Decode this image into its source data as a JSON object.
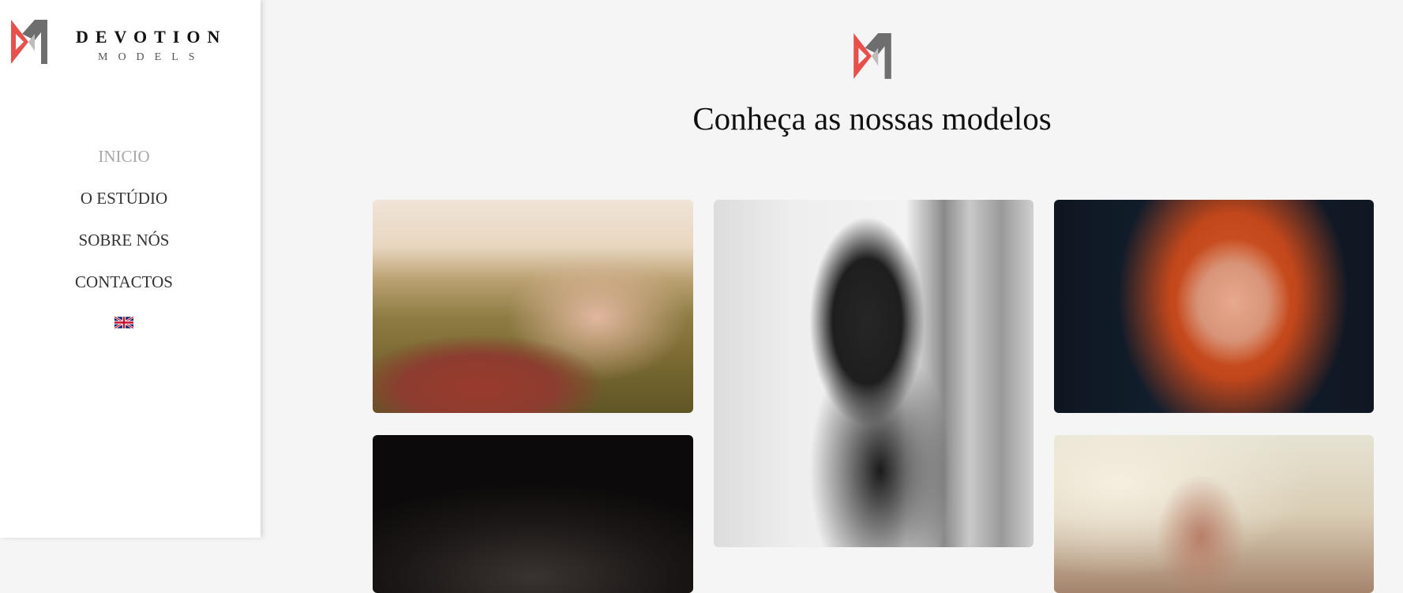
{
  "brand": {
    "name": "DEVOTION",
    "subtitle": "MODELS"
  },
  "nav": {
    "items": [
      {
        "label": "INICIO",
        "active": true
      },
      {
        "label": "O ESTÚDIO",
        "active": false
      },
      {
        "label": "SOBRE NÓS",
        "active": false
      },
      {
        "label": "CONTACTOS",
        "active": false
      }
    ],
    "language_icon": "uk-flag-icon"
  },
  "main": {
    "heading": "Conheça as nossas modelos",
    "gallery": [
      {
        "name": "model-photo-grass"
      },
      {
        "name": "model-photo-black-white"
      },
      {
        "name": "model-photo-red-hair"
      },
      {
        "name": "model-photo-dark"
      },
      {
        "name": "model-photo-sunlight"
      }
    ]
  },
  "colors": {
    "accent_red": "#e8514b",
    "logo_gray": "#6e6e6e",
    "logo_light": "#bdbdbd"
  }
}
